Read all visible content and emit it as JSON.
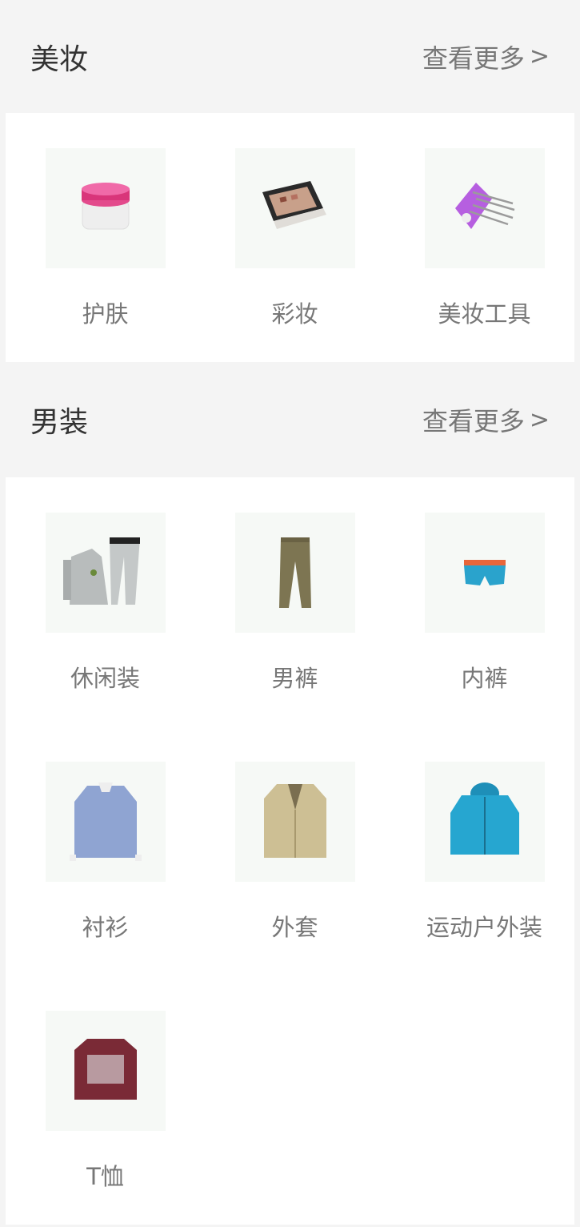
{
  "sections": [
    {
      "title": "美妆",
      "more": "查看更多",
      "items": [
        {
          "label": "护肤",
          "icon": "cream-jar-icon"
        },
        {
          "label": "彩妆",
          "icon": "makeup-palette-icon"
        },
        {
          "label": "美妆工具",
          "icon": "brush-set-icon"
        }
      ]
    },
    {
      "title": "男装",
      "more": "查看更多",
      "items": [
        {
          "label": "休闲装",
          "icon": "casual-suit-icon"
        },
        {
          "label": "男裤",
          "icon": "trousers-icon"
        },
        {
          "label": "内裤",
          "icon": "underwear-icon"
        },
        {
          "label": "衬衫",
          "icon": "shirt-icon"
        },
        {
          "label": "外套",
          "icon": "trench-coat-icon"
        },
        {
          "label": "运动户外装",
          "icon": "outdoor-jacket-icon"
        },
        {
          "label": "T恤",
          "icon": "tshirt-icon"
        }
      ]
    }
  ],
  "colors": {
    "background": "#f4f4f4",
    "panel": "#ffffff",
    "thumb": "#f6f9f6"
  }
}
